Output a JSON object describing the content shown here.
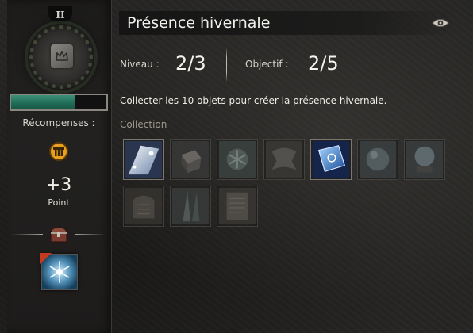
{
  "left_panel": {
    "tier": "II",
    "progress_fraction": 0.67,
    "rewards_title": "Récompenses :",
    "points_value": "+3",
    "points_label": "Point"
  },
  "header": {
    "title": "Présence hivernale"
  },
  "stats": {
    "level_label": "Niveau :",
    "level_value": "2/3",
    "objective_label": "Objectif :",
    "objective_value": "2/5"
  },
  "description": "Collecter les 10 objets pour créer la présence hivernale.",
  "collection": {
    "label": "Collection",
    "items": [
      {
        "name": "snowy-scroll-icon",
        "collected": true
      },
      {
        "name": "gift-box-icon",
        "collected": false
      },
      {
        "name": "snowflake-ornament-icon",
        "collected": false
      },
      {
        "name": "cloth-icon",
        "collected": false
      },
      {
        "name": "blue-tome-icon",
        "collected": true
      },
      {
        "name": "crystal-orb-icon",
        "collected": false
      },
      {
        "name": "snow-globe-icon",
        "collected": false
      },
      {
        "name": "tablet-icon",
        "collected": false
      },
      {
        "name": "feathers-icon",
        "collected": false
      },
      {
        "name": "parchment-icon",
        "collected": false
      }
    ]
  },
  "colors": {
    "progress_fill": "#1f6a55",
    "background": "#262523",
    "text": "#efece5"
  }
}
